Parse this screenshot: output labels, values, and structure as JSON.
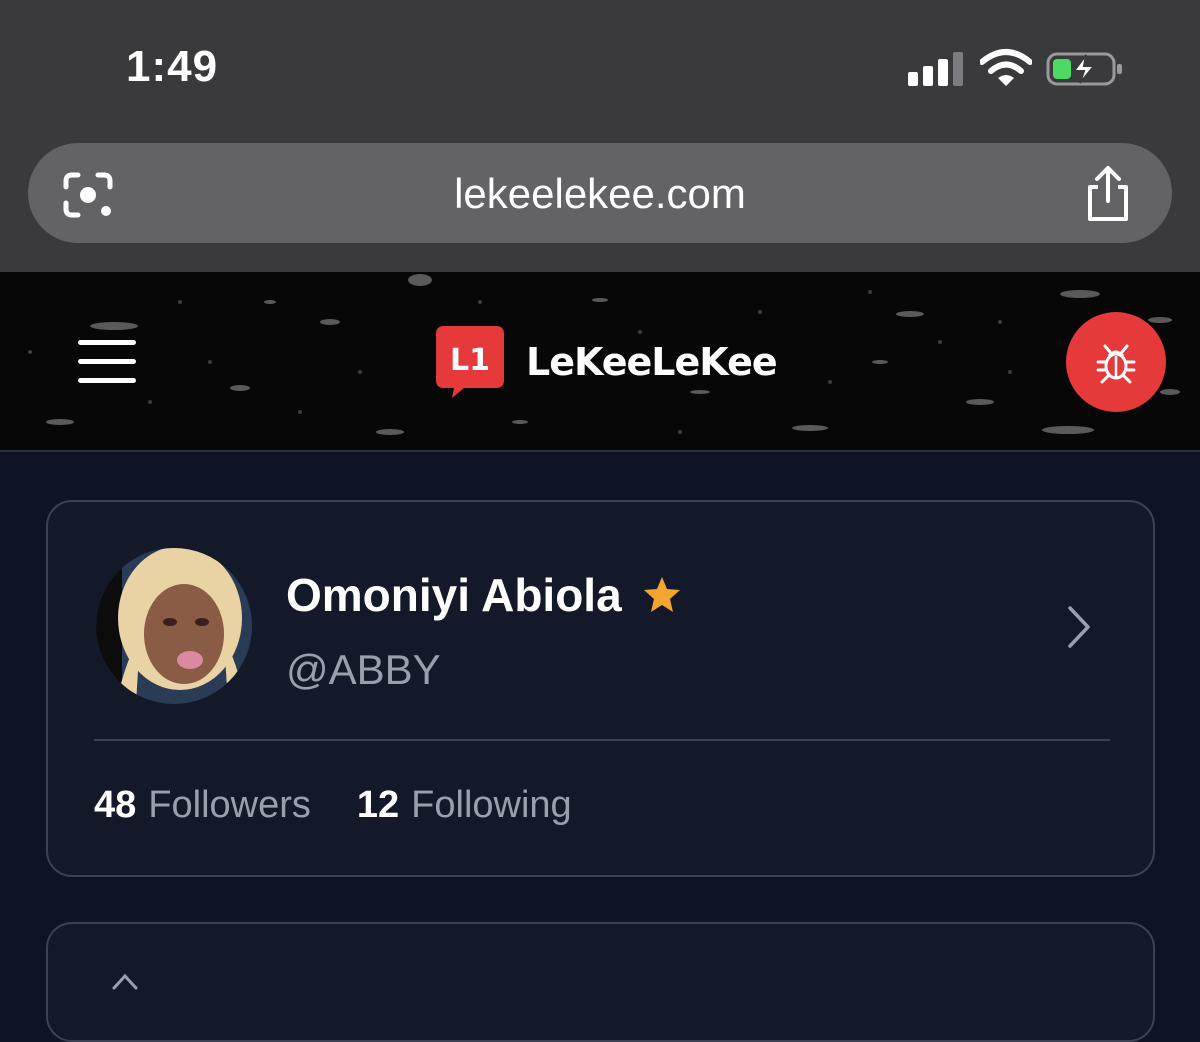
{
  "status_bar": {
    "time": "1:49",
    "icons": [
      "cellular-signal-icon",
      "wifi-icon",
      "battery-charging-icon"
    ]
  },
  "browser": {
    "url": "lekeelekee.com",
    "left_icon": "google-lens-icon",
    "right_icon": "share-icon"
  },
  "site_header": {
    "logo_mark": "L1",
    "logo_text": "LeKeeLeKee",
    "menu_icon": "hamburger-menu-icon",
    "action_icon": "bug-icon",
    "accent_color": "#e63a3a"
  },
  "profile": {
    "name": "Omoniyi Abiola",
    "verified_icon": "star-icon",
    "verified_color": "#f2a531",
    "handle": "@ABBY",
    "followers_count": "48",
    "followers_label": "Followers",
    "following_count": "12",
    "following_label": "Following"
  }
}
